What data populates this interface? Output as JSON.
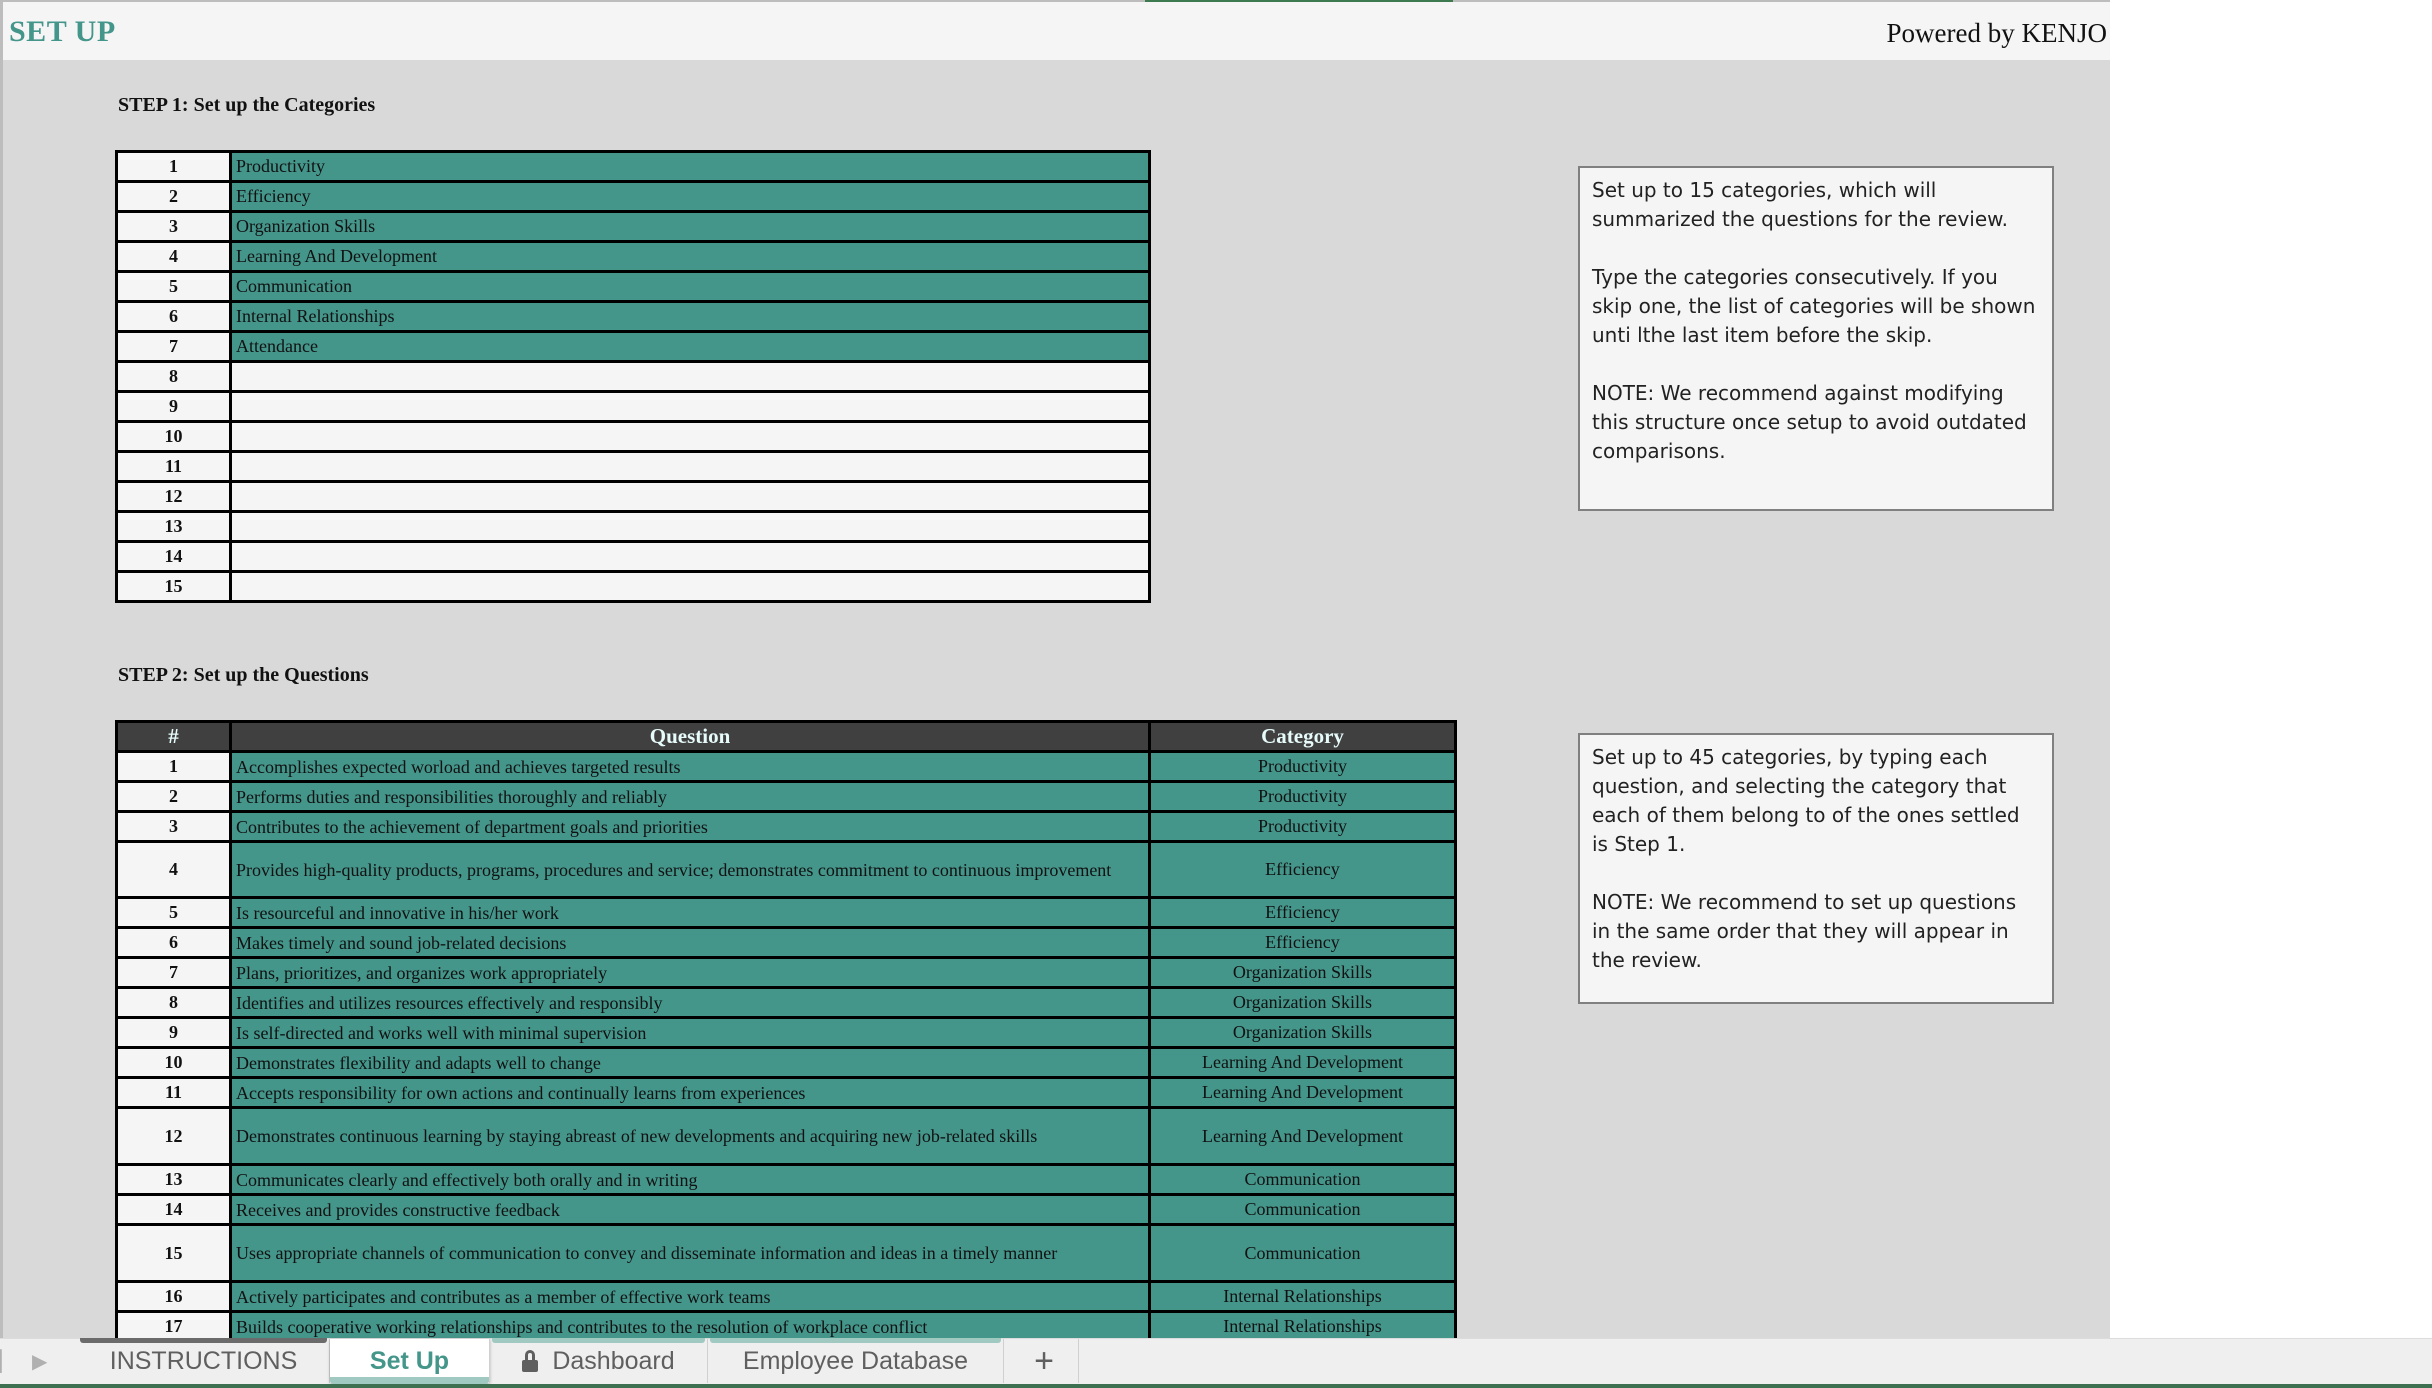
{
  "header": {
    "title": "SET UP",
    "powered_by": "Powered by KENJO"
  },
  "step1": {
    "title": "STEP 1: Set up the Categories",
    "rows": [
      {
        "n": "1",
        "value": "Productivity"
      },
      {
        "n": "2",
        "value": "Efficiency"
      },
      {
        "n": "3",
        "value": "Organization Skills"
      },
      {
        "n": "4",
        "value": "Learning And Development"
      },
      {
        "n": "5",
        "value": "Communication"
      },
      {
        "n": "6",
        "value": "Internal Relationships"
      },
      {
        "n": "7",
        "value": "Attendance"
      },
      {
        "n": "8",
        "value": ""
      },
      {
        "n": "9",
        "value": ""
      },
      {
        "n": "10",
        "value": ""
      },
      {
        "n": "11",
        "value": ""
      },
      {
        "n": "12",
        "value": ""
      },
      {
        "n": "13",
        "value": ""
      },
      {
        "n": "14",
        "value": ""
      },
      {
        "n": "15",
        "value": ""
      }
    ],
    "note": [
      "Set up to 15 categories, which will summarized the questions for the review.",
      "Type the categories consecutively. If you skip one, the list of categories will be shown unti lthe last item before the skip.",
      "NOTE: We recommend against modifying this structure once setup to avoid outdated comparisons."
    ]
  },
  "step2": {
    "title": "STEP 2: Set up the Questions",
    "columns": {
      "num": "#",
      "question": "Question",
      "category": "Category"
    },
    "rows": [
      {
        "n": "1",
        "question": "Accomplishes expected worload and achieves targeted results",
        "category": "Productivity"
      },
      {
        "n": "2",
        "question": "Performs duties and responsibilities thoroughly and reliably",
        "category": "Productivity"
      },
      {
        "n": "3",
        "question": "Contributes to the achievement of department goals and priorities",
        "category": "Productivity"
      },
      {
        "n": "4",
        "question": "Provides high-quality products, programs, procedures and service; demonstrates commitment to continuous improvement",
        "category": "Efficiency"
      },
      {
        "n": "5",
        "question": "Is resourceful and innovative in his/her work",
        "category": "Efficiency"
      },
      {
        "n": "6",
        "question": "Makes timely and sound job-related decisions",
        "category": "Efficiency"
      },
      {
        "n": "7",
        "question": "Plans, prioritizes, and organizes work appropriately",
        "category": "Organization Skills"
      },
      {
        "n": "8",
        "question": "Identifies and utilizes resources effectively and responsibly",
        "category": "Organization Skills"
      },
      {
        "n": "9",
        "question": "Is self-directed and works well with minimal supervision",
        "category": "Organization Skills"
      },
      {
        "n": "10",
        "question": "Demonstrates flexibility and adapts well to change",
        "category": "Learning And Development"
      },
      {
        "n": "11",
        "question": "Accepts responsibility for own actions and continually learns from experiences",
        "category": "Learning And Development"
      },
      {
        "n": "12",
        "question": "Demonstrates continuous learning by staying abreast of new developments and acquiring new job-related skills",
        "category": "Learning And Development"
      },
      {
        "n": "13",
        "question": "Communicates clearly and effectively both orally and in writing",
        "category": "Communication"
      },
      {
        "n": "14",
        "question": "Receives and provides constructive feedback",
        "category": "Communication"
      },
      {
        "n": "15",
        "question": "Uses appropriate channels of communication to convey and disseminate information and ideas in a timely manner",
        "category": "Communication"
      },
      {
        "n": "16",
        "question": "Actively participates and contributes as a member of effective work teams",
        "category": "Internal Relationships"
      },
      {
        "n": "17",
        "question": "Builds cooperative working relationships and contributes to the resolution of workplace conflict",
        "category": "Internal Relationships"
      }
    ],
    "note": [
      "Set up to 45 categories, by typing each question, and selecting the category that each of them belong to of the ones settled is Step 1.",
      "NOTE: We recommend to set up questions in the same order that they will appear in the review."
    ]
  },
  "tabs": [
    {
      "label": "INSTRUCTIONS",
      "active": false,
      "locked": false
    },
    {
      "label": "Set Up",
      "active": true,
      "locked": false
    },
    {
      "label": "Dashboard",
      "active": false,
      "locked": true
    },
    {
      "label": "Employee Database",
      "active": false,
      "locked": false
    }
  ],
  "add_tab_label": "+",
  "colors": {
    "accent_teal": "#44958a",
    "header_dark": "#404040",
    "sheet_bg": "#d9d9d9",
    "cell_light": "#f5f5f5"
  }
}
